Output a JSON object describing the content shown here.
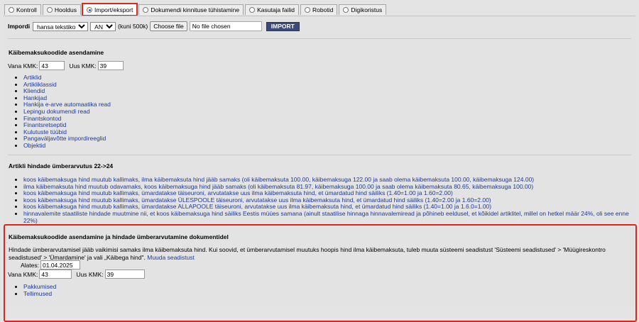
{
  "tabs": [
    {
      "label": "Kontroll",
      "selected": false
    },
    {
      "label": "Hooldus",
      "selected": false
    },
    {
      "label": "Import/eksport",
      "selected": true
    },
    {
      "label": "Dokumendi kinnituse tühistamine",
      "selected": false
    },
    {
      "label": "Kasutaja failid",
      "selected": false
    },
    {
      "label": "Robotid",
      "selected": false
    },
    {
      "label": "Digikoristus",
      "selected": false
    }
  ],
  "import": {
    "label": "Impordi",
    "source_selected": "hansa tekstikoopia",
    "encoding_selected": "ANSI",
    "size_note": "(kuni 500k)",
    "choose_file_label": "Choose file",
    "file_status": "No file chosen",
    "import_button": "IMPORT"
  },
  "kmk_section": {
    "heading": "Käibemaksukoodide asendamine",
    "old_label": "Vana KMK:",
    "old_value": "43",
    "new_label": "Uus KMK:",
    "new_value": "39",
    "links": [
      "Artiklid",
      "Artikliklassid",
      "Kliendid",
      "Hankijad",
      "Hankija e-arve automaatika read",
      "Lepingu dokumendi read",
      "Finantskontod",
      "Finantsretseptid",
      "Kulutuste tüübid",
      "Pangaväljavõtte impordireeglid",
      "Objektid"
    ]
  },
  "price_section": {
    "heading": "Artikli hindade ümberarvutus 22->24",
    "links": [
      "koos käibemaksuga hind muutub kallimaks, ilma käibemaksuta hind jääb samaks (oli käibemaksuta 100.00, käibemaksuga 122.00 ja saab olema käibemaksuta 100.00, käibemaksuga 124.00)",
      "ilma käibemaksuta hind muutub odavamaks, koos käibemaksuga hind jääb samaks (oli käibemaksuta 81.97, käibemaksuga 100.00 ja saab olema käibemaksuta 80.65, käibemaksuga 100.00)",
      "koos käibemaksuga hind muutub kallimaks, ümardatakse täiseuroni, arvutatakse uus ilma käibemaksuta hind, et ümardatud hind säiliks (1.40=1.00 ja 1.60=2.00)",
      "koos käibemaksuga hind muutub kallimaks, ümardatakse ÜLESPOOLE täiseuroni, arvutatakse uus ilma käibemaksuta hind, et ümardatud hind säiliks (1.40=2.00 ja 1.60=2.00)",
      "koos käibemaksuga hind muutub kallimaks, ümardatakse ALLAPOOLE täiseuroni, arvutatakse uus ilma käibemaksuta hind, et ümardatud hind säiliks (1.40=1.00 ja 1.6.0=1.00)",
      "hinnavalemite staatiliste hindade muutmine nii, et koos käibemaksuga hind säiliks Eestis müües samana (ainult staatilise hinnaga hinnavalemiread ja põhineb eeldusel, et kõikidel artiklitel, millel on hetkel määr 24%, oli see enne 22%)"
    ]
  },
  "doc_section": {
    "heading": "Käibemaksukoodide asendamine ja hindade ümberarvutamine dokumentidel",
    "paragraph": "Hindade ümberarvutamisel jääb vaikimisi samaks ilma käibemaksuta hind. Kui soovid, et ümberarvutamisel muutuks hoopis hind ilma käibemaksuta, tuleb muuta süsteemi seadistust 'Süsteemi seadistused' > 'Müügireskontro seadistused' > 'Ümardamine' ja vali „Käibega hind\".",
    "settings_link": "Muuda seadistust",
    "from_label": "Alates:",
    "from_value": "01.04.2025",
    "old_label": "Vana KMK:",
    "old_value": "43",
    "new_label": "Uus KMK:",
    "new_value": "39",
    "links": [
      "Pakkumised",
      "Tellimused"
    ]
  },
  "colors": {
    "accent": "#e0261c",
    "link": "#1d3a9a",
    "button": "#3b4a78"
  }
}
